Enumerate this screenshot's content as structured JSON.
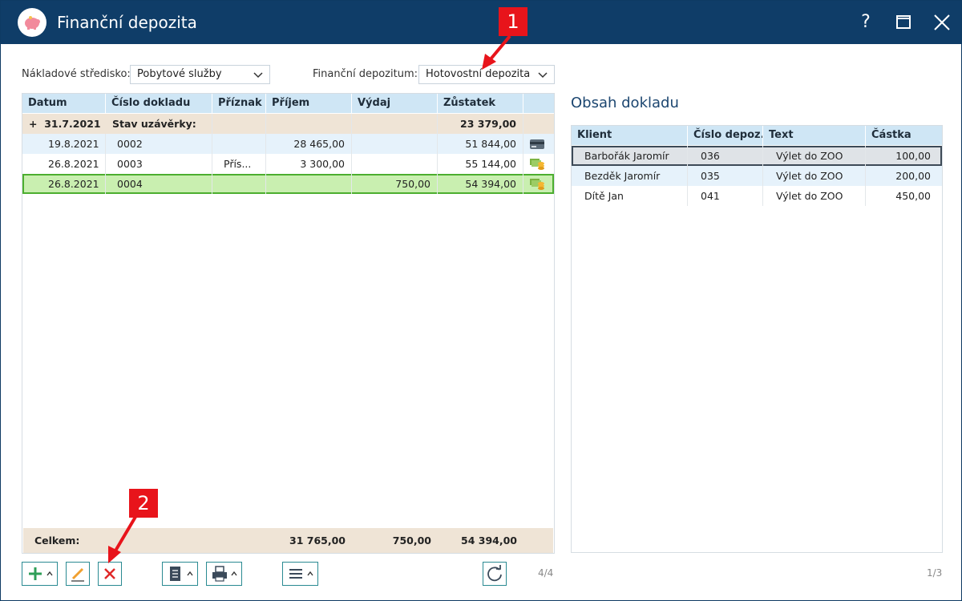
{
  "window": {
    "title": "Finanční depozita"
  },
  "titlebar": {
    "help": "?",
    "max_icon": "maximize-icon",
    "close_icon": "close-icon"
  },
  "filters": {
    "cost_center_label": "Nákladové středisko:",
    "cost_center_value": "Pobytové služby",
    "deposit_label": "Finanční depozitum:",
    "deposit_value": "Hotovostní depozita"
  },
  "left_grid": {
    "headers": [
      "Datum",
      "Číslo dokladu",
      "Příznak",
      "Příjem",
      "Výdaj",
      "Zůstatek"
    ],
    "group": {
      "expander": "+",
      "date": "31.7.2021",
      "label": "Stav uzávěrky:",
      "balance": "23 379,00"
    },
    "rows": [
      {
        "date": "19.8.2021",
        "doc": "0002",
        "flag": "",
        "income": "28 465,00",
        "expense": "",
        "balance": "51 844,00",
        "icon": "card-icon"
      },
      {
        "date": "26.8.2021",
        "doc": "0003",
        "flag": "Přís...",
        "income": "3 300,00",
        "expense": "",
        "balance": "55 144,00",
        "icon": "cash-icon"
      },
      {
        "date": "26.8.2021",
        "doc": "0004",
        "flag": "",
        "income": "",
        "expense": "750,00",
        "balance": "54 394,00",
        "icon": "cash-icon"
      }
    ],
    "footer": {
      "label": "Celkem:",
      "income": "31 765,00",
      "expense": "750,00",
      "balance": "54 394,00"
    },
    "counter": "4/4"
  },
  "right_panel": {
    "title": "Obsah dokladu",
    "headers": [
      "Klient",
      "Číslo depoz...",
      "Text",
      "Částka"
    ],
    "rows": [
      {
        "client": "Barbořák Jaromír",
        "number": "036",
        "text": "Výlet do ZOO",
        "amount": "100,00"
      },
      {
        "client": "Bezděk Jaromír",
        "number": "035",
        "text": "Výlet do ZOO",
        "amount": "200,00"
      },
      {
        "client": "Dítě Jan",
        "number": "041",
        "text": "Výlet do ZOO",
        "amount": "450,00"
      }
    ],
    "counter": "1/3"
  },
  "toolbar": {
    "add_icon": "add-icon",
    "edit_icon": "pencil-icon",
    "delete_icon": "delete-icon",
    "doc_icon": "document-icon",
    "print_icon": "print-icon",
    "menu_icon": "menu-icon",
    "refresh_icon": "refresh-icon"
  },
  "callouts": {
    "one": "1",
    "two": "2"
  },
  "colors": {
    "titlebar": "#0f3d68",
    "header": "#cfe6f5",
    "selected": "#c9efb0",
    "accent": "#2a8a92",
    "callout": "#e8141b"
  }
}
